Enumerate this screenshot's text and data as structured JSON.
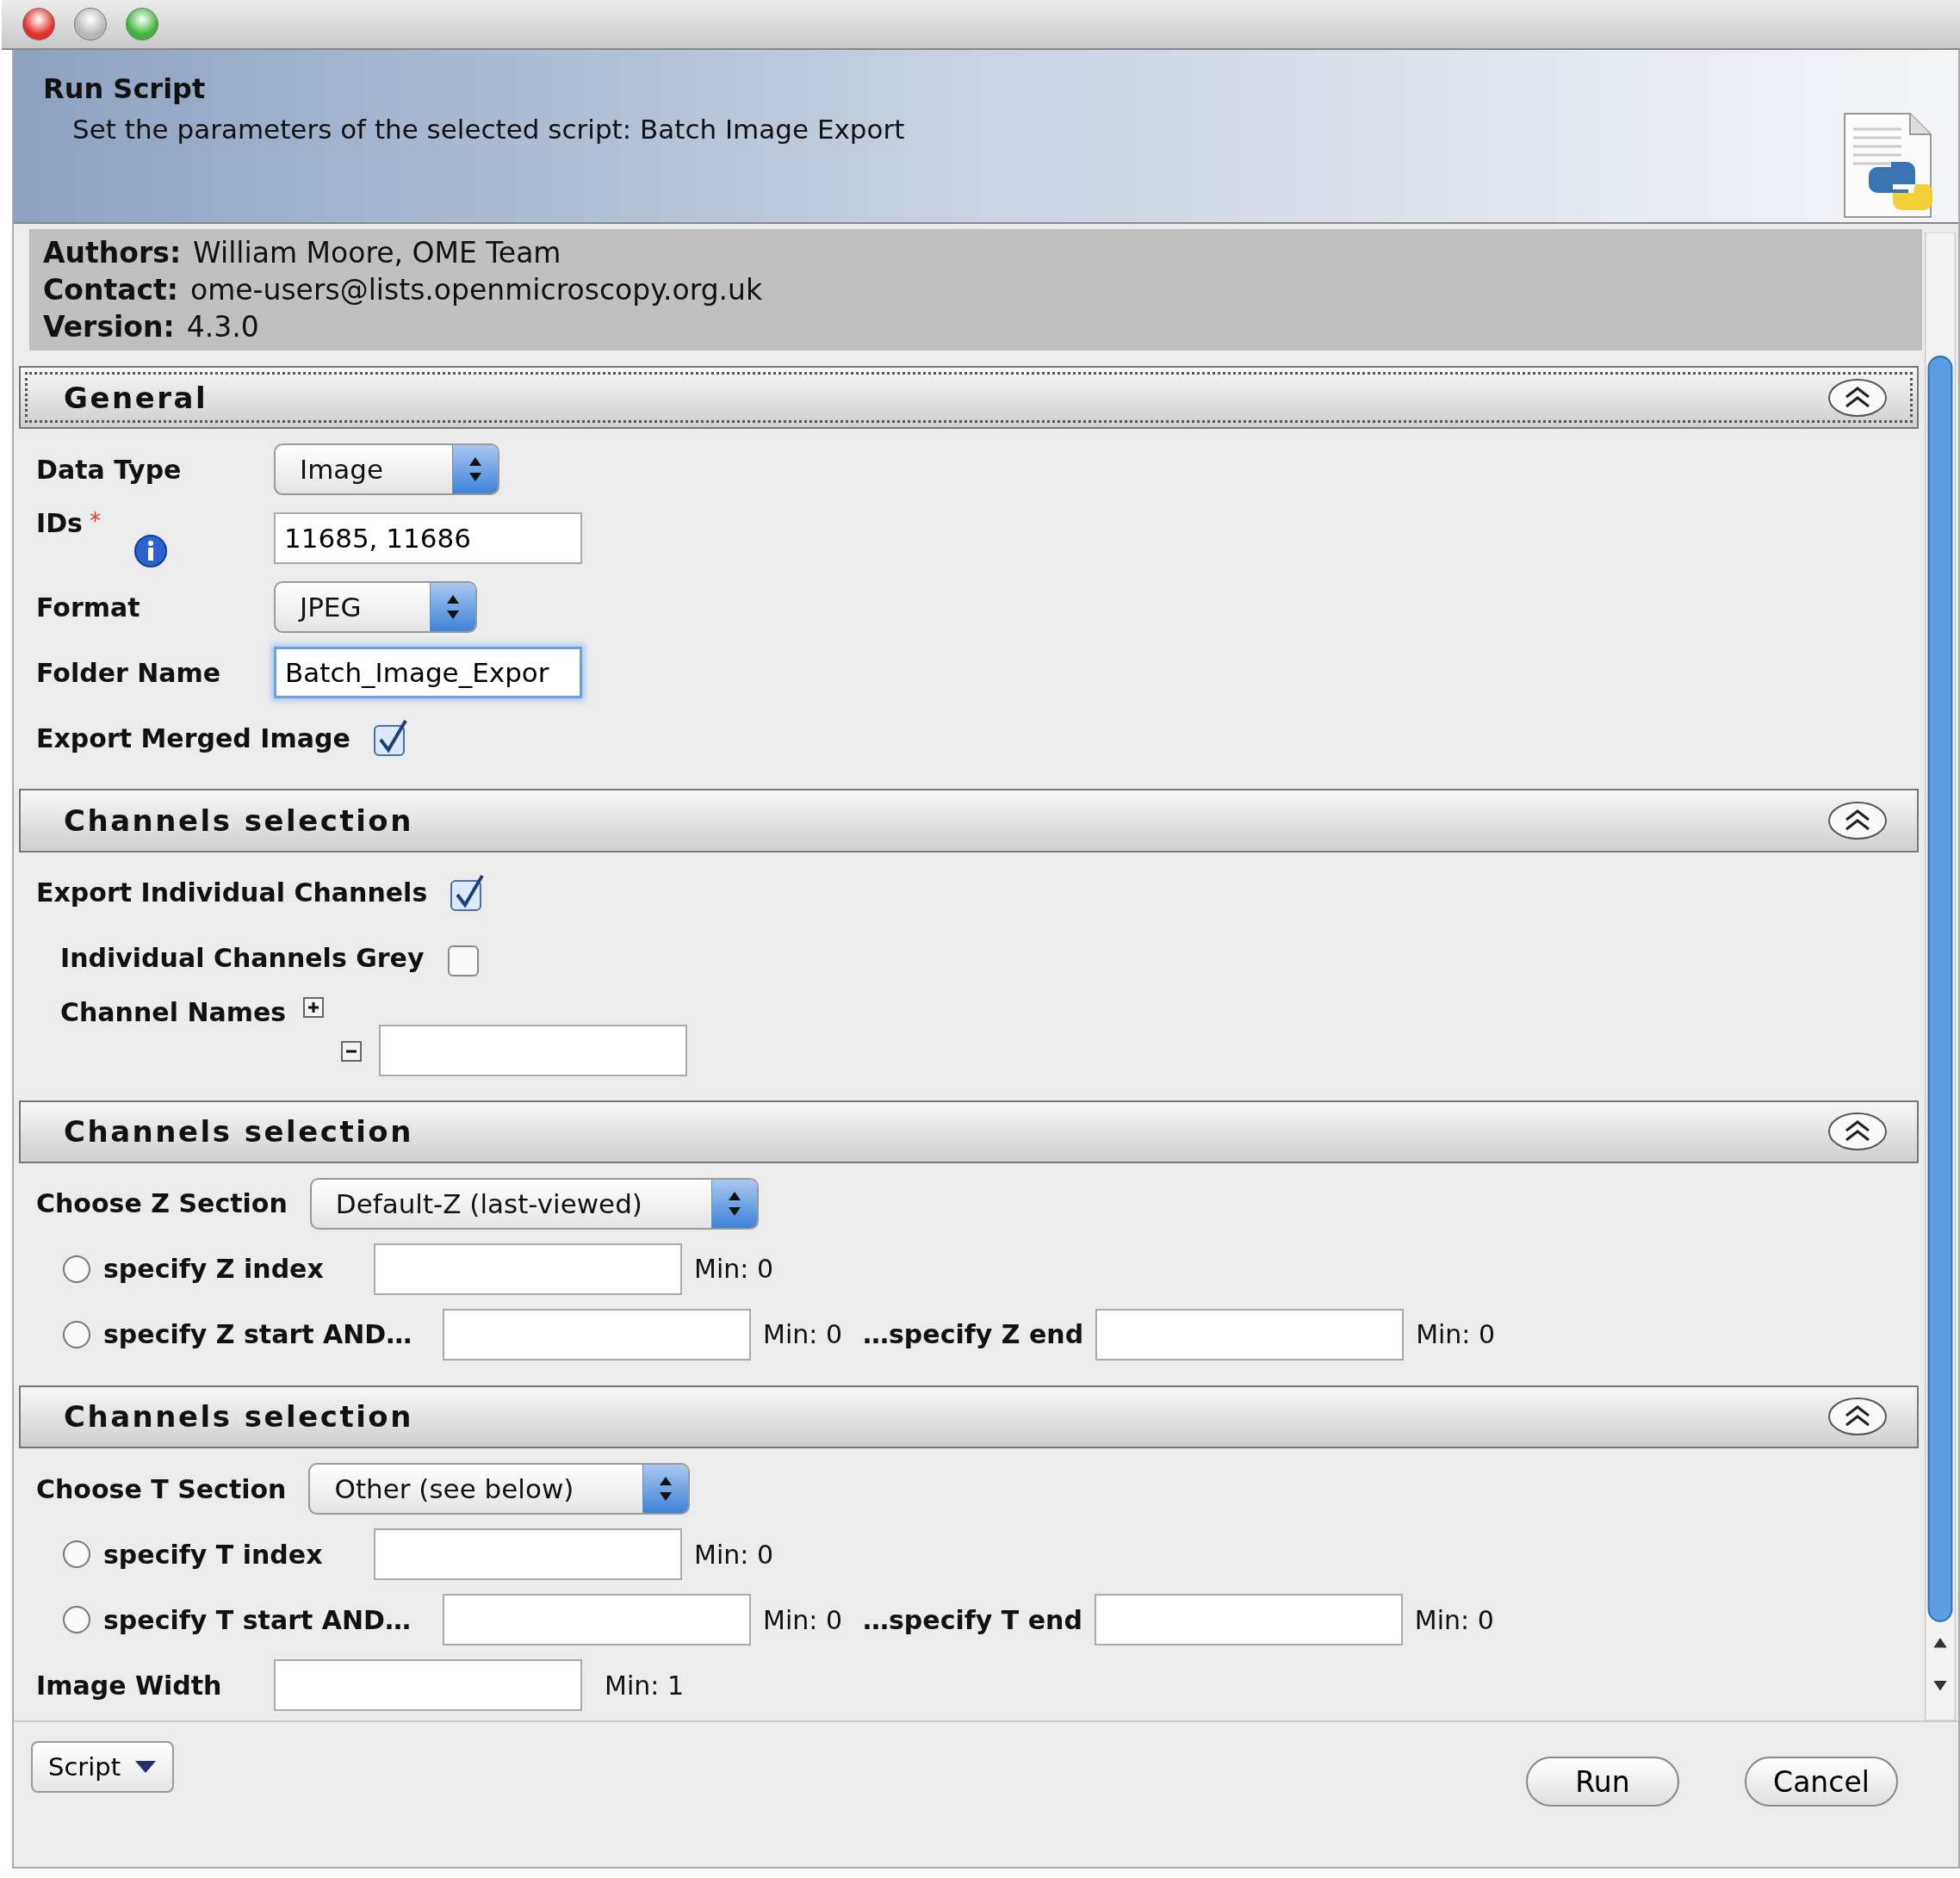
{
  "window": {
    "title": "Run Script",
    "subtitle": "Set the parameters of the selected script: Batch Image Export"
  },
  "info": [
    {
      "label": "Authors:",
      "value": "William Moore, OME Team"
    },
    {
      "label": "Contact:",
      "value": "ome-users@lists.openmicroscopy.org.uk"
    },
    {
      "label": "Version:",
      "value": "4.3.0"
    }
  ],
  "sections": [
    {
      "title": "General",
      "focused": true,
      "rows": [
        {
          "kind": "select",
          "label": "Data Type",
          "value": "Image"
        },
        {
          "kind": "field",
          "label": "IDs",
          "required_mark": "*",
          "info": true,
          "value": "11685, 11686",
          "focused": false
        },
        {
          "kind": "select",
          "label": "Format",
          "value": "JPEG"
        },
        {
          "kind": "field",
          "label": "Folder Name",
          "value": "Batch_Image_Expor",
          "focused": true
        },
        {
          "kind": "checkbox",
          "label": "Export Merged Image",
          "checked": true
        }
      ]
    },
    {
      "title": "Channels selection",
      "focused": false,
      "rows": [
        {
          "kind": "checkbox",
          "label": "Export Individual Channels",
          "checked": true,
          "children": [
            {
              "kind": "checkbox",
              "label": "Individual Channels Grey",
              "checked": false
            },
            {
              "kind": "list",
              "label": "Channel Names"
            }
          ]
        }
      ]
    },
    {
      "title": "Channels selection",
      "focused": false,
      "rows": [
        {
          "kind": "select",
          "label": "Choose Z Section",
          "value": "Default-Z (last-viewed)"
        },
        {
          "kind": "radio",
          "label": "specify Z index",
          "selected": false,
          "min": "Min: 0"
        },
        {
          "kind": "radio",
          "label": "specify Z start AND…",
          "selected": false,
          "min": "Min: 0",
          "end_label": "…specify Z end",
          "end_min": "Min: 0"
        }
      ]
    },
    {
      "title": "Channels selection",
      "focused": false,
      "rows": [
        {
          "kind": "select",
          "label": "Choose T Section",
          "value": "Other (see below)"
        },
        {
          "kind": "radio",
          "label": "specify T index",
          "selected": false,
          "min": "Min: 0"
        },
        {
          "kind": "radio",
          "label": "specify T start AND…",
          "selected": false,
          "min": "Min: 0",
          "end_label": "…specify T end",
          "end_min": "Min: 0"
        },
        {
          "kind": "field",
          "label": "Image Width",
          "min": "Min: 1",
          "focused": false
        }
      ]
    }
  ],
  "footer": {
    "menu": "Script",
    "buttons": [
      "Run",
      "Cancel"
    ]
  }
}
